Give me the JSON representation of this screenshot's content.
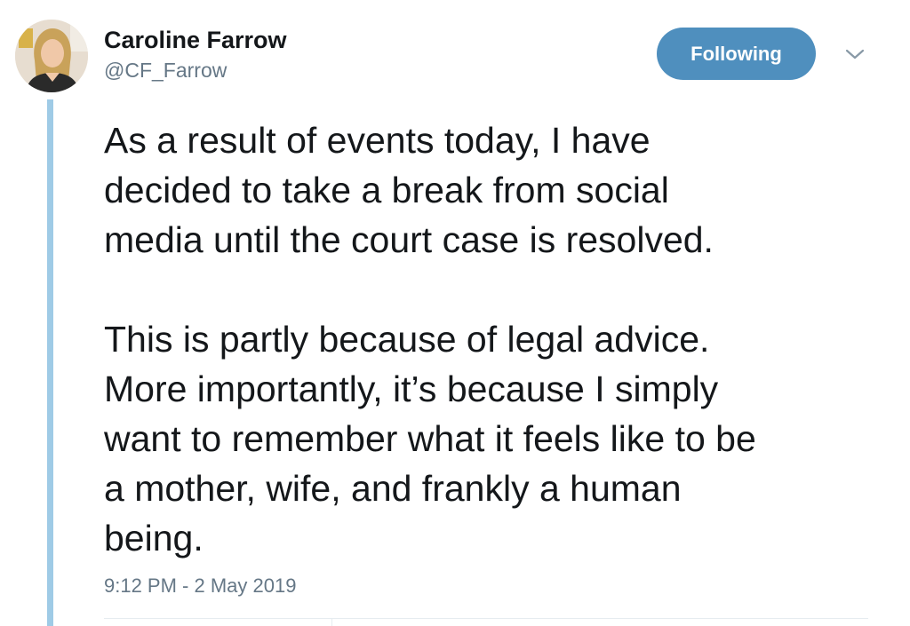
{
  "tweet": {
    "author": {
      "display_name": "Caroline Farrow",
      "handle": "@CF_Farrow",
      "avatar_icon": "profile-photo"
    },
    "follow_button_label": "Following",
    "more_icon": "chevron-down-icon",
    "text_paragraphs": [
      "As a result of events today, I have\ndecided to take a break from social\nmedia until the court case is resolved.",
      "This is partly because of legal advice.\nMore importantly, it’s because  I simply\nwant to remember what it feels like to be\na mother, wife, and frankly a human\nbeing."
    ],
    "timestamp": "9:12 PM - 2 May 2019"
  },
  "colors": {
    "accent": "#4f8fbe",
    "thread_line": "#9fcbe6",
    "secondary_text": "#657786",
    "primary_text": "#14171a"
  }
}
